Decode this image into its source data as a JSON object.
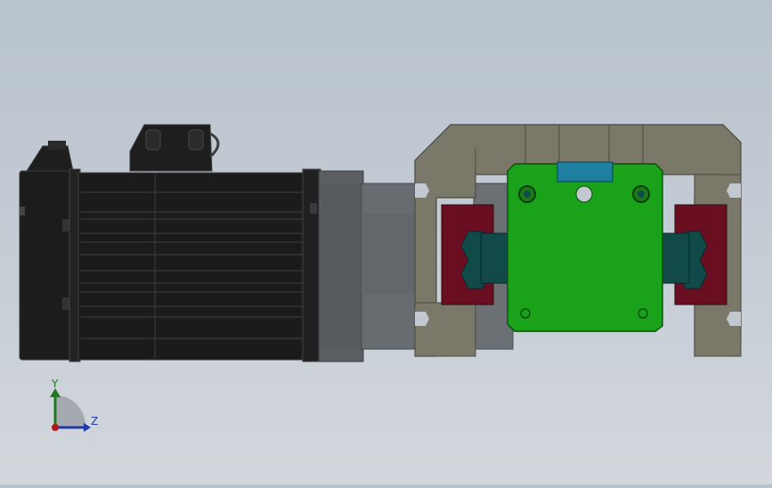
{
  "viewport": {
    "background_top": "#b9c3cd",
    "background_bottom": "#d3d7dc"
  },
  "colors": {
    "motor_body": "#1b1b1b",
    "motor_edge": "#3d3d3d",
    "gearbox": "#5c6064",
    "frame": "#7a7868",
    "carriage_plate": "#1aa31a",
    "rail_block": "#6a0f22",
    "roller": "#124a4a",
    "sensor_tab": "#1e7fa0"
  },
  "triad": {
    "y_label": "Y",
    "z_label": "Z",
    "y_color": "#1e7a1e",
    "z_color": "#1f3aa8",
    "x_color": "#b01818",
    "x_origin_icon": "axis-origin-icon"
  }
}
